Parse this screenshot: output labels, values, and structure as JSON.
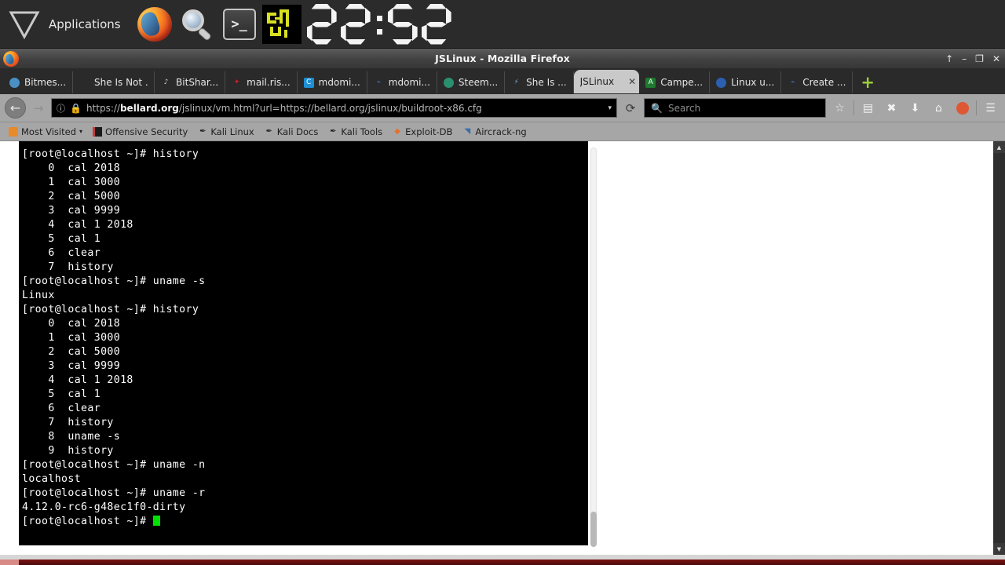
{
  "panel": {
    "menu_icon": "triangle-down-icon",
    "applications_label": "Applications",
    "launchers": [
      {
        "name": "firefox-icon",
        "label": "Firefox"
      },
      {
        "name": "magnifier-icon",
        "label": "Search"
      },
      {
        "name": "terminal-icon",
        "label": "Terminal",
        "glyph": ">_"
      },
      {
        "name": "pixel-app-icon",
        "label": "App"
      }
    ],
    "clock": {
      "display": "22:52",
      "hours": "22",
      "minutes": "52",
      "separator": ":"
    }
  },
  "window": {
    "title": "JSLinux - Mozilla Firefox",
    "buttons": {
      "shade": "↑",
      "minimize": "–",
      "maximize": "❐",
      "close": "✕"
    }
  },
  "tabs": [
    {
      "label": "Bitmes...",
      "favicon": "sphere-icon",
      "color": "#4a90c4",
      "active": false
    },
    {
      "label": "She Is Not ...",
      "favicon": "blank-icon",
      "color": "#555555",
      "active": false
    },
    {
      "label": "BitShar...",
      "favicon": "bitshares-icon",
      "color": "#1a1a1a",
      "active": false
    },
    {
      "label": "mail.ris...",
      "favicon": "star-icon",
      "color": "#d0202a",
      "active": false
    },
    {
      "label": "mdomi...",
      "favicon": "c-badge-icon",
      "color": "#1e8fd5",
      "active": false
    },
    {
      "label": "mdomi...",
      "favicon": "steemit-icon",
      "color": "#4d7cc7",
      "active": false
    },
    {
      "label": "Steem...",
      "favicon": "steem-icon",
      "color": "#2a8f6e",
      "active": false
    },
    {
      "label": "She Is ...",
      "favicon": "bolt-icon",
      "color": "#6fa8dc",
      "active": false
    },
    {
      "label": "JSLinux",
      "favicon": "none",
      "color": "#c9c9c9",
      "active": true,
      "close": "✕"
    },
    {
      "label": "Campe...",
      "favicon": "a-badge-icon",
      "color": "#1e7a2e",
      "active": false
    },
    {
      "label": "Linux u...",
      "favicon": "moon-icon",
      "color": "#2b5fb0",
      "active": false
    },
    {
      "label": "Create ...",
      "favicon": "steemit-icon",
      "color": "#4d7cc7",
      "active": false
    }
  ],
  "new_tab_label": "+",
  "navbar": {
    "back_icon": "←",
    "forward_icon": "→",
    "identity_icon": "info-icon",
    "lock_icon": "lock-icon",
    "url_prefix": "https://",
    "url_domain": "bellard.org",
    "url_path": "/jslinux/vm.html?url=https://bellard.org/jslinux/buildroot-x86.cfg",
    "url_full": "https://bellard.org/jslinux/vm.html?url=https://bellard.org/jslinux/buildroot-x86.cfg",
    "dropdown_icon": "▾",
    "reload_icon": "⟳",
    "search_placeholder": "Search",
    "search_value": "",
    "icons": [
      {
        "name": "bookmark-star-icon",
        "glyph": "☆"
      },
      {
        "name": "reader-list-icon",
        "glyph": "▤"
      },
      {
        "name": "pocket-icon",
        "glyph": "▼"
      },
      {
        "name": "downloads-icon",
        "glyph": "⬇"
      },
      {
        "name": "home-icon",
        "glyph": "⌂"
      },
      {
        "name": "duckduckgo-icon",
        "glyph": "●"
      },
      {
        "name": "hamburger-menu-icon",
        "glyph": "☰"
      }
    ]
  },
  "bookmarks": [
    {
      "label": "Most Visited",
      "icon": "folder-star-icon",
      "color": "#e8892a",
      "caret": "▾"
    },
    {
      "label": "Offensive Security",
      "icon": "offsec-icon",
      "color": "#c43b3b",
      "caret": ""
    },
    {
      "label": "Kali Linux",
      "icon": "dragon-icon",
      "color": "#222222",
      "caret": ""
    },
    {
      "label": "Kali Docs",
      "icon": "dragon-icon",
      "color": "#222222",
      "caret": ""
    },
    {
      "label": "Kali Tools",
      "icon": "dragon-icon",
      "color": "#222222",
      "caret": ""
    },
    {
      "label": "Exploit-DB",
      "icon": "flame-icon",
      "color": "#e8702a",
      "caret": ""
    },
    {
      "label": "Aircrack-ng",
      "icon": "shark-fin-icon",
      "color": "#3a6ea5",
      "caret": ""
    }
  ],
  "terminal": {
    "prompt": "[root@localhost ~]#",
    "cursor": "block-cursor",
    "lines": [
      "[root@localhost ~]# history",
      "    0  cal 2018",
      "    1  cal 3000",
      "    2  cal 5000",
      "    3  cal 9999",
      "    4  cal 1 2018",
      "    5  cal 1",
      "    6  clear",
      "    7  history",
      "[root@localhost ~]# uname -s",
      "Linux",
      "[root@localhost ~]# history",
      "    0  cal 2018",
      "    1  cal 3000",
      "    2  cal 5000",
      "    3  cal 9999",
      "    4  cal 1 2018",
      "    5  cal 1",
      "    6  clear",
      "    7  history",
      "    8  uname -s",
      "    9  history",
      "[root@localhost ~]# uname -n",
      "localhost",
      "[root@localhost ~]# uname -r",
      "4.12.0-rc6-g48ec1f0-dirty"
    ],
    "last_prompt": "[root@localhost ~]# "
  },
  "scrollbars": {
    "page_up_arrow": "▲",
    "page_down_arrow": "▼"
  },
  "colors": {
    "terminal_bg": "#000000",
    "terminal_fg": "#ffffff",
    "cursor": "#00e000",
    "panel_bg": "#2b2b2b",
    "toolbar_bg": "#a6a6a6",
    "accent_red": "#7d1212"
  }
}
